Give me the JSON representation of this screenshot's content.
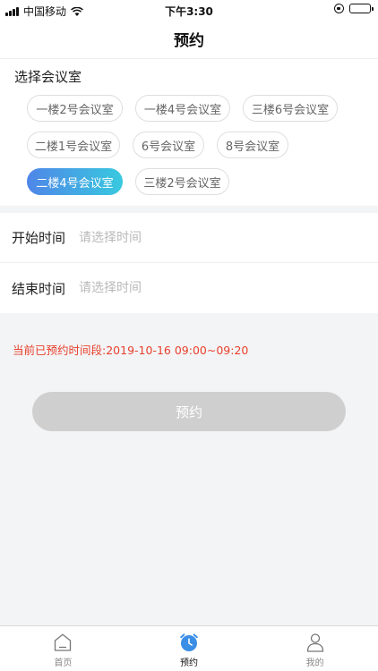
{
  "status_bar": {
    "carrier": "中国移动",
    "time": "下午3:30"
  },
  "nav": {
    "title": "预约"
  },
  "rooms": {
    "section_title": "选择会议室",
    "rows": [
      [
        {
          "label": "一楼2号会议室",
          "selected": false
        },
        {
          "label": "一楼4号会议室",
          "selected": false
        },
        {
          "label": "三楼6号会议室",
          "selected": false
        }
      ],
      [
        {
          "label": "二楼1号会议室",
          "selected": false
        },
        {
          "label": "6号会议室",
          "selected": false
        },
        {
          "label": "8号会议室",
          "selected": false
        }
      ],
      [
        {
          "label": "二楼4号会议室",
          "selected": true
        },
        {
          "label": "三楼2号会议室",
          "selected": false
        }
      ]
    ]
  },
  "time": {
    "start_label": "开始时间",
    "start_placeholder": "请选择时间",
    "end_label": "结束时间",
    "end_placeholder": "请选择时间"
  },
  "booked_info": "当前已预约时间段:2019-10-16 09:00~09:20",
  "reserve_button": "预约",
  "tab_bar": {
    "items": [
      {
        "label": "首页",
        "icon": "home-icon",
        "active": false
      },
      {
        "label": "预约",
        "icon": "alarm-clock-icon",
        "active": true
      },
      {
        "label": "我的",
        "icon": "person-icon",
        "active": false
      }
    ]
  },
  "colors": {
    "accent_gradient_start": "#4f86e8",
    "accent_gradient_end": "#38c9df",
    "booked_text": "#e8412d",
    "button_disabled": "#cfcfcf",
    "tab_active_icon": "#3a8ee6"
  }
}
